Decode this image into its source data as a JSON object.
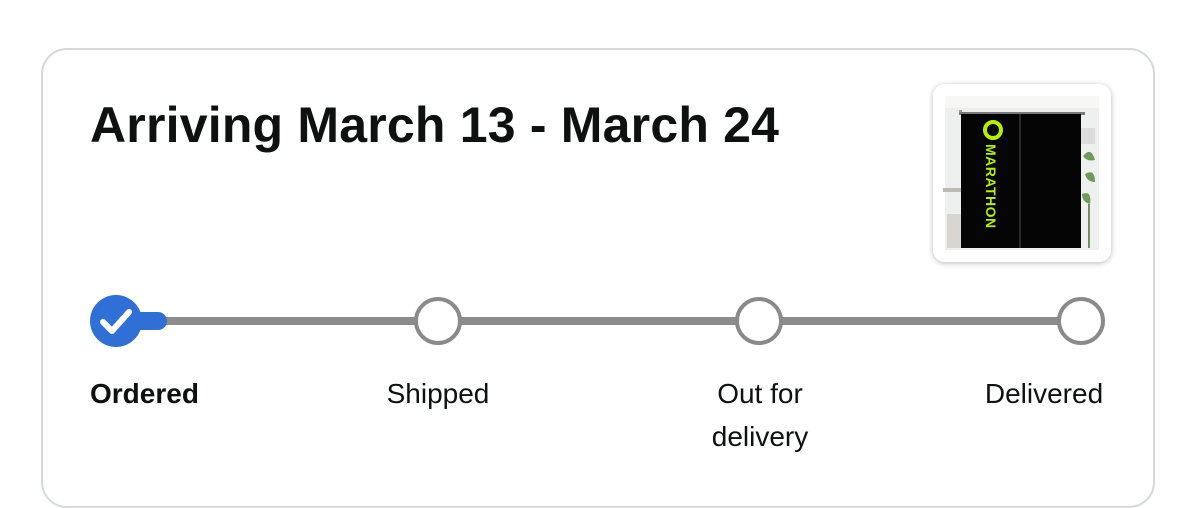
{
  "delivery": {
    "title": "Arriving March 13 - March 24"
  },
  "product": {
    "image_icon": "curtain-product-image",
    "brand_text": "MARATHON",
    "accent_color": "#b6f000"
  },
  "tracker": {
    "accent_color": "#2f6fd6",
    "inactive_color": "#8a8a8a",
    "steps": [
      {
        "label": "Ordered",
        "status": "done"
      },
      {
        "label": "Shipped",
        "status": "pending"
      },
      {
        "label": "Out for delivery",
        "status": "pending"
      },
      {
        "label": "Delivered",
        "status": "pending"
      }
    ]
  }
}
